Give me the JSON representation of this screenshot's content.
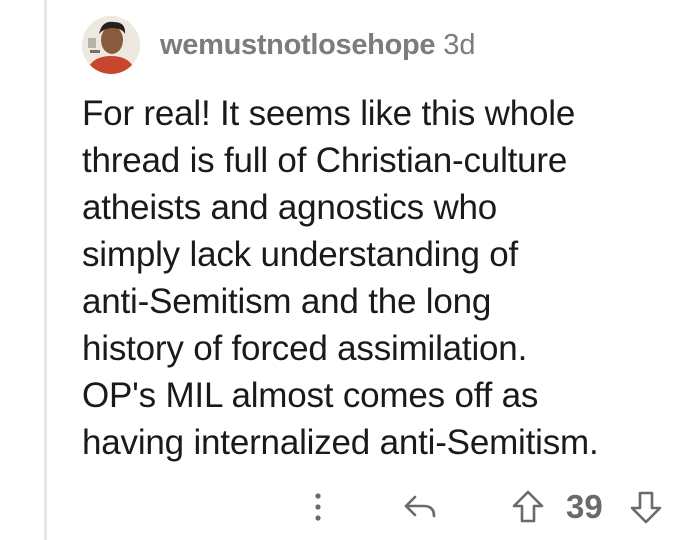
{
  "comment": {
    "username": "wemustnotlosehope",
    "age": "3d",
    "body_lines": [
      "For real! It seems like this whole",
      "thread is full of Christian-culture",
      "atheists and agnostics who",
      "simply lack understanding of",
      "anti-Semitism and the long",
      "history of forced assimilation.",
      "OP's MIL almost comes off as",
      "having internalized anti-Semitism."
    ],
    "score": "39"
  },
  "icons": {
    "more": "vertical-ellipsis-icon",
    "reply": "reply-arrow-icon",
    "upvote": "upvote-arrow-icon",
    "downvote": "downvote-arrow-icon"
  },
  "colors": {
    "meta_text": "#7c7c7c",
    "body_text": "#1a1a1b",
    "thread_line": "#e4e5e6",
    "action_icons": "#6a6a6a"
  }
}
